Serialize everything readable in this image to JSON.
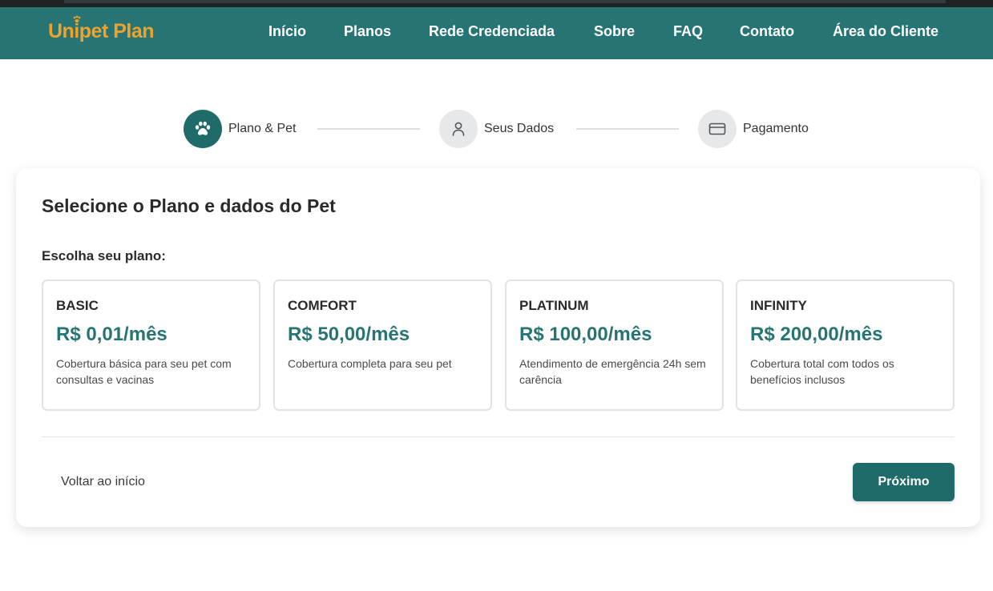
{
  "brand": {
    "name": "Unipet Plan",
    "color": "#f0a22b"
  },
  "nav": {
    "items": [
      {
        "label": "Início"
      },
      {
        "label": "Planos"
      },
      {
        "label": "Rede Credenciada"
      },
      {
        "label": "Sobre"
      },
      {
        "label": "FAQ"
      },
      {
        "label": "Contato"
      },
      {
        "label": "Área do Cliente"
      }
    ]
  },
  "stepper": {
    "steps": [
      {
        "label": "Plano & Pet",
        "icon": "paw-icon",
        "state": "active"
      },
      {
        "label": "Seus Dados",
        "icon": "user-icon",
        "state": "inactive"
      },
      {
        "label": "Pagamento",
        "icon": "credit-card-icon",
        "state": "inactive"
      }
    ]
  },
  "form": {
    "title": "Selecione o Plano e dados do Pet",
    "plan_section_label": "Escolha seu plano:",
    "plans": [
      {
        "name": "BASIC",
        "price": "R$ 0,01/mês",
        "description": "Cobertura básica para seu pet com consultas e vacinas"
      },
      {
        "name": "COMFORT",
        "price": "R$ 50,00/mês",
        "description": "Cobertura completa para seu pet"
      },
      {
        "name": "PLATINUM",
        "price": "R$ 100,00/mês",
        "description": "Atendimento de emergência 24h sem carência"
      },
      {
        "name": "INFINITY",
        "price": "R$ 200,00/mês",
        "description": "Cobertura total com todos os benefícios inclusos"
      }
    ],
    "back_label": "Voltar ao início",
    "next_label": "Próximo"
  },
  "colors": {
    "primary": "#267574",
    "primary_dark": "#1f6b69",
    "accent": "#f0a22b"
  }
}
